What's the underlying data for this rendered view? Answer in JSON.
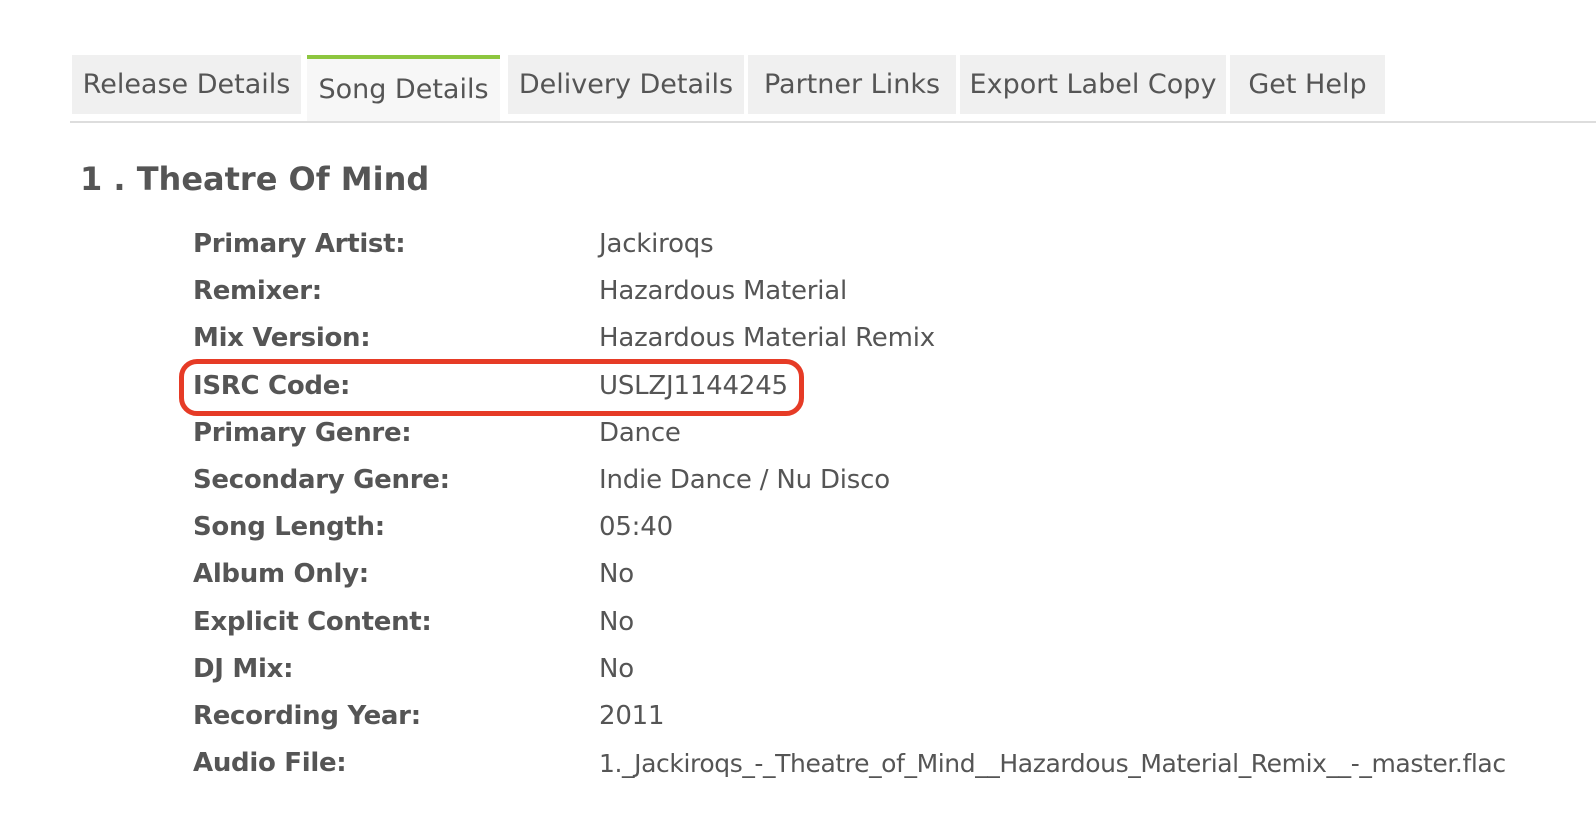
{
  "tabs": [
    {
      "label": "Release Details",
      "active": false
    },
    {
      "label": "Song Details",
      "active": true
    },
    {
      "label": "Delivery Details",
      "active": false
    },
    {
      "label": "Partner Links",
      "active": false
    },
    {
      "label": "Export Label Copy",
      "active": false
    },
    {
      "label": "Get Help",
      "active": false
    }
  ],
  "song": {
    "title": "1 . Theatre Of Mind",
    "details": [
      {
        "label": "Primary Artist:",
        "value": "Jackiroqs"
      },
      {
        "label": "Remixer:",
        "value": "Hazardous Material"
      },
      {
        "label": "Mix Version:",
        "value": "Hazardous Material Remix"
      },
      {
        "label": "ISRC Code:",
        "value": "USLZJ1144245"
      },
      {
        "label": "Primary Genre:",
        "value": "Dance"
      },
      {
        "label": "Secondary Genre:",
        "value": "Indie Dance / Nu Disco"
      },
      {
        "label": "Song Length:",
        "value": "05:40"
      },
      {
        "label": "Album Only:",
        "value": "No"
      },
      {
        "label": "Explicit Content:",
        "value": "No"
      },
      {
        "label": "DJ Mix:",
        "value": "No"
      },
      {
        "label": "Recording Year:",
        "value": "2011"
      },
      {
        "label": "Audio File:",
        "value": "1._Jackiroqs_-_Theatre_of_Mind__Hazardous_Material_Remix__-_master.flac"
      }
    ]
  },
  "highlight": {
    "target": "ISRC Code:",
    "color": "#e63b26"
  },
  "colors": {
    "accent": "#8dc63f",
    "highlight": "#e63b26",
    "tab_bg": "#f0f0f0",
    "text": "#555555"
  }
}
